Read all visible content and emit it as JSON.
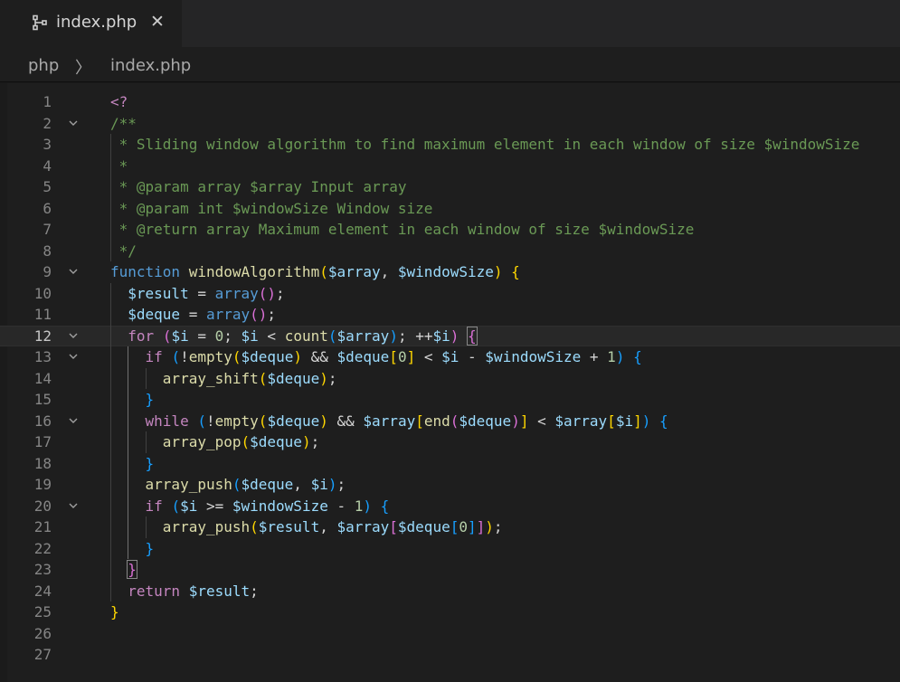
{
  "tab": {
    "title": "index.php",
    "close_glyph": "✕",
    "icon": "source-control-icon"
  },
  "breadcrumb": {
    "items": [
      "php",
      "index.php"
    ],
    "separator": "〉"
  },
  "editor": {
    "active_line": 12,
    "colors": {
      "background": "#1e1e1e",
      "comment": "#6a9955",
      "keyword": "#569cd6",
      "control": "#c586c0",
      "function": "#dcdcaa",
      "variable": "#9cdcfe",
      "number": "#b5cea8",
      "bracket1": "#ffd700",
      "bracket2": "#da70d6",
      "bracket3": "#179fff"
    },
    "lines": [
      {
        "n": "1",
        "fold": false,
        "tokens": [
          [
            "t-php",
            "<?"
          ]
        ]
      },
      {
        "n": "2",
        "fold": true,
        "tokens": [
          [
            "t-cmt",
            "/**"
          ]
        ]
      },
      {
        "n": "3",
        "fold": false,
        "tokens": [
          [
            "t-cmt",
            " * Sliding window algorithm to find maximum element in each window of size $windowSize"
          ]
        ]
      },
      {
        "n": "4",
        "fold": false,
        "tokens": [
          [
            "t-cmt",
            " *"
          ]
        ]
      },
      {
        "n": "5",
        "fold": false,
        "tokens": [
          [
            "t-cmt",
            " * @param array $array Input array"
          ]
        ]
      },
      {
        "n": "6",
        "fold": false,
        "tokens": [
          [
            "t-cmt",
            " * @param int $windowSize Window size"
          ]
        ]
      },
      {
        "n": "7",
        "fold": false,
        "tokens": [
          [
            "t-cmt",
            " * @return array Maximum element in each window of size $windowSize"
          ]
        ]
      },
      {
        "n": "8",
        "fold": false,
        "tokens": [
          [
            "t-cmt",
            " */"
          ]
        ]
      },
      {
        "n": "9",
        "fold": true,
        "tokens": [
          [
            "t-kw",
            "function"
          ],
          [
            "t-op",
            " "
          ],
          [
            "t-fn",
            "windowAlgorithm"
          ],
          [
            "t-b1",
            "("
          ],
          [
            "t-var",
            "$array"
          ],
          [
            "t-op",
            ", "
          ],
          [
            "t-var",
            "$windowSize"
          ],
          [
            "t-b1",
            ")"
          ],
          [
            "t-op",
            " "
          ],
          [
            "t-b1",
            "{"
          ]
        ]
      },
      {
        "n": "10",
        "fold": false,
        "tokens": [
          [
            "t-op",
            "  "
          ],
          [
            "t-var",
            "$result"
          ],
          [
            "t-op",
            " = "
          ],
          [
            "t-kw",
            "array"
          ],
          [
            "t-b2",
            "()"
          ],
          [
            "t-op",
            ";"
          ]
        ]
      },
      {
        "n": "11",
        "fold": false,
        "tokens": [
          [
            "t-op",
            "  "
          ],
          [
            "t-var",
            "$deque"
          ],
          [
            "t-op",
            " = "
          ],
          [
            "t-kw",
            "array"
          ],
          [
            "t-b2",
            "()"
          ],
          [
            "t-op",
            ";"
          ]
        ]
      },
      {
        "n": "12",
        "fold": true,
        "tokens": [
          [
            "t-op",
            "  "
          ],
          [
            "t-ctl",
            "for"
          ],
          [
            "t-op",
            " "
          ],
          [
            "t-b2",
            "("
          ],
          [
            "t-var",
            "$i"
          ],
          [
            "t-op",
            " = "
          ],
          [
            "t-num",
            "0"
          ],
          [
            "t-op",
            "; "
          ],
          [
            "t-var",
            "$i"
          ],
          [
            "t-op",
            " < "
          ],
          [
            "t-fn",
            "count"
          ],
          [
            "t-b3",
            "("
          ],
          [
            "t-var",
            "$array"
          ],
          [
            "t-b3",
            ")"
          ],
          [
            "t-op",
            "; ++"
          ],
          [
            "t-var",
            "$i"
          ],
          [
            "t-b2",
            ")"
          ],
          [
            "t-op",
            " "
          ],
          [
            "t-b2 bracket-match",
            "{"
          ]
        ]
      },
      {
        "n": "13",
        "fold": true,
        "tokens": [
          [
            "t-op",
            "    "
          ],
          [
            "t-ctl",
            "if"
          ],
          [
            "t-op",
            " "
          ],
          [
            "t-b3",
            "("
          ],
          [
            "t-op",
            "!"
          ],
          [
            "t-fn",
            "empty"
          ],
          [
            "t-b1",
            "("
          ],
          [
            "t-var",
            "$deque"
          ],
          [
            "t-b1",
            ")"
          ],
          [
            "t-op",
            " && "
          ],
          [
            "t-var",
            "$deque"
          ],
          [
            "t-b1",
            "["
          ],
          [
            "t-num",
            "0"
          ],
          [
            "t-b1",
            "]"
          ],
          [
            "t-op",
            " < "
          ],
          [
            "t-var",
            "$i"
          ],
          [
            "t-op",
            " - "
          ],
          [
            "t-var",
            "$windowSize"
          ],
          [
            "t-op",
            " + "
          ],
          [
            "t-num",
            "1"
          ],
          [
            "t-b3",
            ")"
          ],
          [
            "t-op",
            " "
          ],
          [
            "t-b3",
            "{"
          ]
        ]
      },
      {
        "n": "14",
        "fold": false,
        "tokens": [
          [
            "t-op",
            "      "
          ],
          [
            "t-fn",
            "array_shift"
          ],
          [
            "t-b1",
            "("
          ],
          [
            "t-var",
            "$deque"
          ],
          [
            "t-b1",
            ")"
          ],
          [
            "t-op",
            ";"
          ]
        ]
      },
      {
        "n": "15",
        "fold": false,
        "tokens": [
          [
            "t-op",
            "    "
          ],
          [
            "t-b3",
            "}"
          ]
        ]
      },
      {
        "n": "16",
        "fold": true,
        "tokens": [
          [
            "t-op",
            "    "
          ],
          [
            "t-ctl",
            "while"
          ],
          [
            "t-op",
            " "
          ],
          [
            "t-b3",
            "("
          ],
          [
            "t-op",
            "!"
          ],
          [
            "t-fn",
            "empty"
          ],
          [
            "t-b1",
            "("
          ],
          [
            "t-var",
            "$deque"
          ],
          [
            "t-b1",
            ")"
          ],
          [
            "t-op",
            " && "
          ],
          [
            "t-var",
            "$array"
          ],
          [
            "t-b1",
            "["
          ],
          [
            "t-fn",
            "end"
          ],
          [
            "t-b2",
            "("
          ],
          [
            "t-var",
            "$deque"
          ],
          [
            "t-b2",
            ")"
          ],
          [
            "t-b1",
            "]"
          ],
          [
            "t-op",
            " < "
          ],
          [
            "t-var",
            "$array"
          ],
          [
            "t-b1",
            "["
          ],
          [
            "t-var",
            "$i"
          ],
          [
            "t-b1",
            "]"
          ],
          [
            "t-b3",
            ")"
          ],
          [
            "t-op",
            " "
          ],
          [
            "t-b3",
            "{"
          ]
        ]
      },
      {
        "n": "17",
        "fold": false,
        "tokens": [
          [
            "t-op",
            "      "
          ],
          [
            "t-fn",
            "array_pop"
          ],
          [
            "t-b1",
            "("
          ],
          [
            "t-var",
            "$deque"
          ],
          [
            "t-b1",
            ")"
          ],
          [
            "t-op",
            ";"
          ]
        ]
      },
      {
        "n": "18",
        "fold": false,
        "tokens": [
          [
            "t-op",
            "    "
          ],
          [
            "t-b3",
            "}"
          ]
        ]
      },
      {
        "n": "19",
        "fold": false,
        "tokens": [
          [
            "t-op",
            "    "
          ],
          [
            "t-fn",
            "array_push"
          ],
          [
            "t-b3",
            "("
          ],
          [
            "t-var",
            "$deque"
          ],
          [
            "t-op",
            ", "
          ],
          [
            "t-var",
            "$i"
          ],
          [
            "t-b3",
            ")"
          ],
          [
            "t-op",
            ";"
          ]
        ]
      },
      {
        "n": "20",
        "fold": true,
        "tokens": [
          [
            "t-op",
            "    "
          ],
          [
            "t-ctl",
            "if"
          ],
          [
            "t-op",
            " "
          ],
          [
            "t-b3",
            "("
          ],
          [
            "t-var",
            "$i"
          ],
          [
            "t-op",
            " >= "
          ],
          [
            "t-var",
            "$windowSize"
          ],
          [
            "t-op",
            " - "
          ],
          [
            "t-num",
            "1"
          ],
          [
            "t-b3",
            ")"
          ],
          [
            "t-op",
            " "
          ],
          [
            "t-b3",
            "{"
          ]
        ]
      },
      {
        "n": "21",
        "fold": false,
        "tokens": [
          [
            "t-op",
            "      "
          ],
          [
            "t-fn",
            "array_push"
          ],
          [
            "t-b1",
            "("
          ],
          [
            "t-var",
            "$result"
          ],
          [
            "t-op",
            ", "
          ],
          [
            "t-var",
            "$array"
          ],
          [
            "t-b2",
            "["
          ],
          [
            "t-var",
            "$deque"
          ],
          [
            "t-b3",
            "["
          ],
          [
            "t-num",
            "0"
          ],
          [
            "t-b3",
            "]"
          ],
          [
            "t-b2",
            "]"
          ],
          [
            "t-b1",
            ")"
          ],
          [
            "t-op",
            ";"
          ]
        ]
      },
      {
        "n": "22",
        "fold": false,
        "tokens": [
          [
            "t-op",
            "    "
          ],
          [
            "t-b3",
            "}"
          ]
        ]
      },
      {
        "n": "23",
        "fold": false,
        "tokens": [
          [
            "t-op",
            "  "
          ],
          [
            "t-b2 bracket-match",
            "}"
          ]
        ]
      },
      {
        "n": "24",
        "fold": false,
        "tokens": [
          [
            "t-op",
            "  "
          ],
          [
            "t-ctl",
            "return"
          ],
          [
            "t-op",
            " "
          ],
          [
            "t-var",
            "$result"
          ],
          [
            "t-op",
            ";"
          ]
        ]
      },
      {
        "n": "25",
        "fold": false,
        "tokens": [
          [
            "t-b1",
            "}"
          ]
        ]
      },
      {
        "n": "26",
        "fold": false,
        "tokens": []
      },
      {
        "n": "27",
        "fold": false,
        "tokens": []
      }
    ]
  }
}
